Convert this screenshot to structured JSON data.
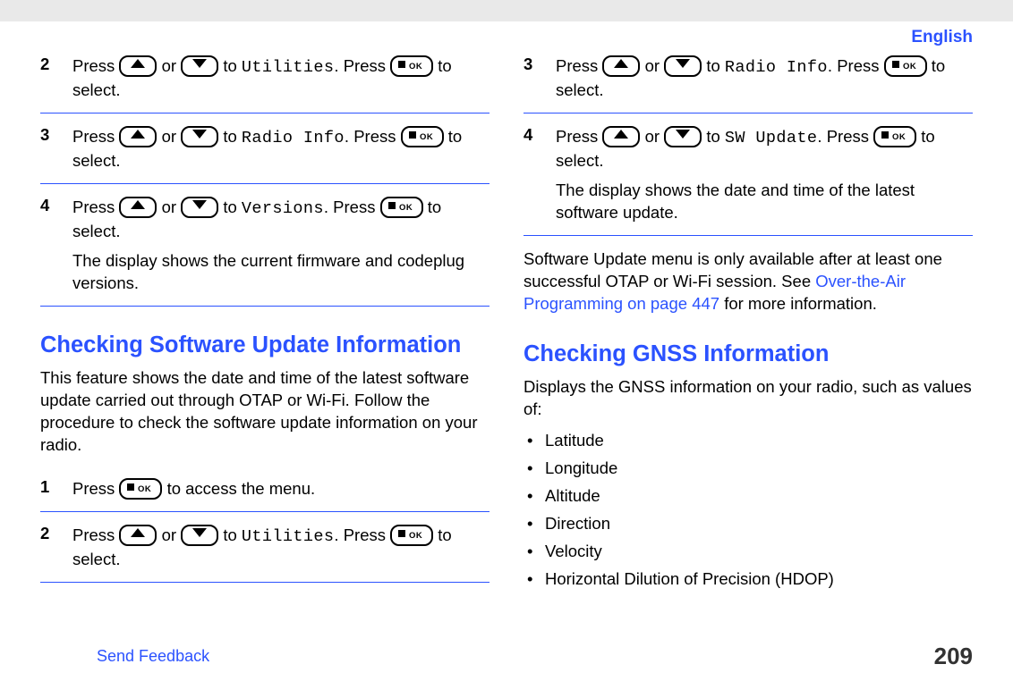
{
  "lang": "English",
  "left": {
    "steps_a": [
      {
        "num": "2",
        "pre": "Press ",
        "or": " or ",
        "to": " to ",
        "item": "Utilities",
        "post1": ". Press ",
        "post2": " to select."
      },
      {
        "num": "3",
        "pre": "Press ",
        "or": " or ",
        "to": " to ",
        "item": "Radio Info",
        "post1": ". Press ",
        "post2": " to select."
      },
      {
        "num": "4",
        "pre": "Press ",
        "or": " or ",
        "to": " to ",
        "item": "Versions",
        "post1": ". Press ",
        "post2": " to select.",
        "extra": "The display shows the current firmware and codeplug versions."
      }
    ],
    "section": "Checking Software Update Information",
    "section_intro": "This feature shows the date and time of the latest software update carried out through OTAP or Wi-Fi. Follow the procedure to check the software update information on your radio.",
    "steps_b": [
      {
        "num": "1",
        "pre": "Press ",
        "post": " to access the menu."
      },
      {
        "num": "2",
        "pre": "Press ",
        "or": " or ",
        "to": " to ",
        "item": "Utilities",
        "post1": ". Press ",
        "post2": " to select."
      }
    ]
  },
  "right": {
    "steps": [
      {
        "num": "3",
        "pre": "Press ",
        "or": " or ",
        "to": " to ",
        "item": "Radio Info",
        "post1": ". Press ",
        "post2": " to select."
      },
      {
        "num": "4",
        "pre": "Press ",
        "or": " or ",
        "to": " to ",
        "item": "SW Update",
        "post1": ". Press ",
        "post2": " to select.",
        "extra": "The display shows the date and time of the latest software update."
      }
    ],
    "post_para_1": "Software Update menu is only available after at least one successful OTAP or Wi-Fi session. See ",
    "post_link": "Over-the-Air Programming on page 447",
    "post_para_2": " for more information.",
    "section": "Checking GNSS Information",
    "section_intro": "Displays the GNSS information on your radio, such as values of:",
    "bullets": [
      "Latitude",
      "Longitude",
      "Altitude",
      "Direction",
      "Velocity",
      "Horizontal Dilution of Precision (HDOP)"
    ]
  },
  "footer_link": "Send Feedback",
  "page_num": "209",
  "ok_label": "OK"
}
